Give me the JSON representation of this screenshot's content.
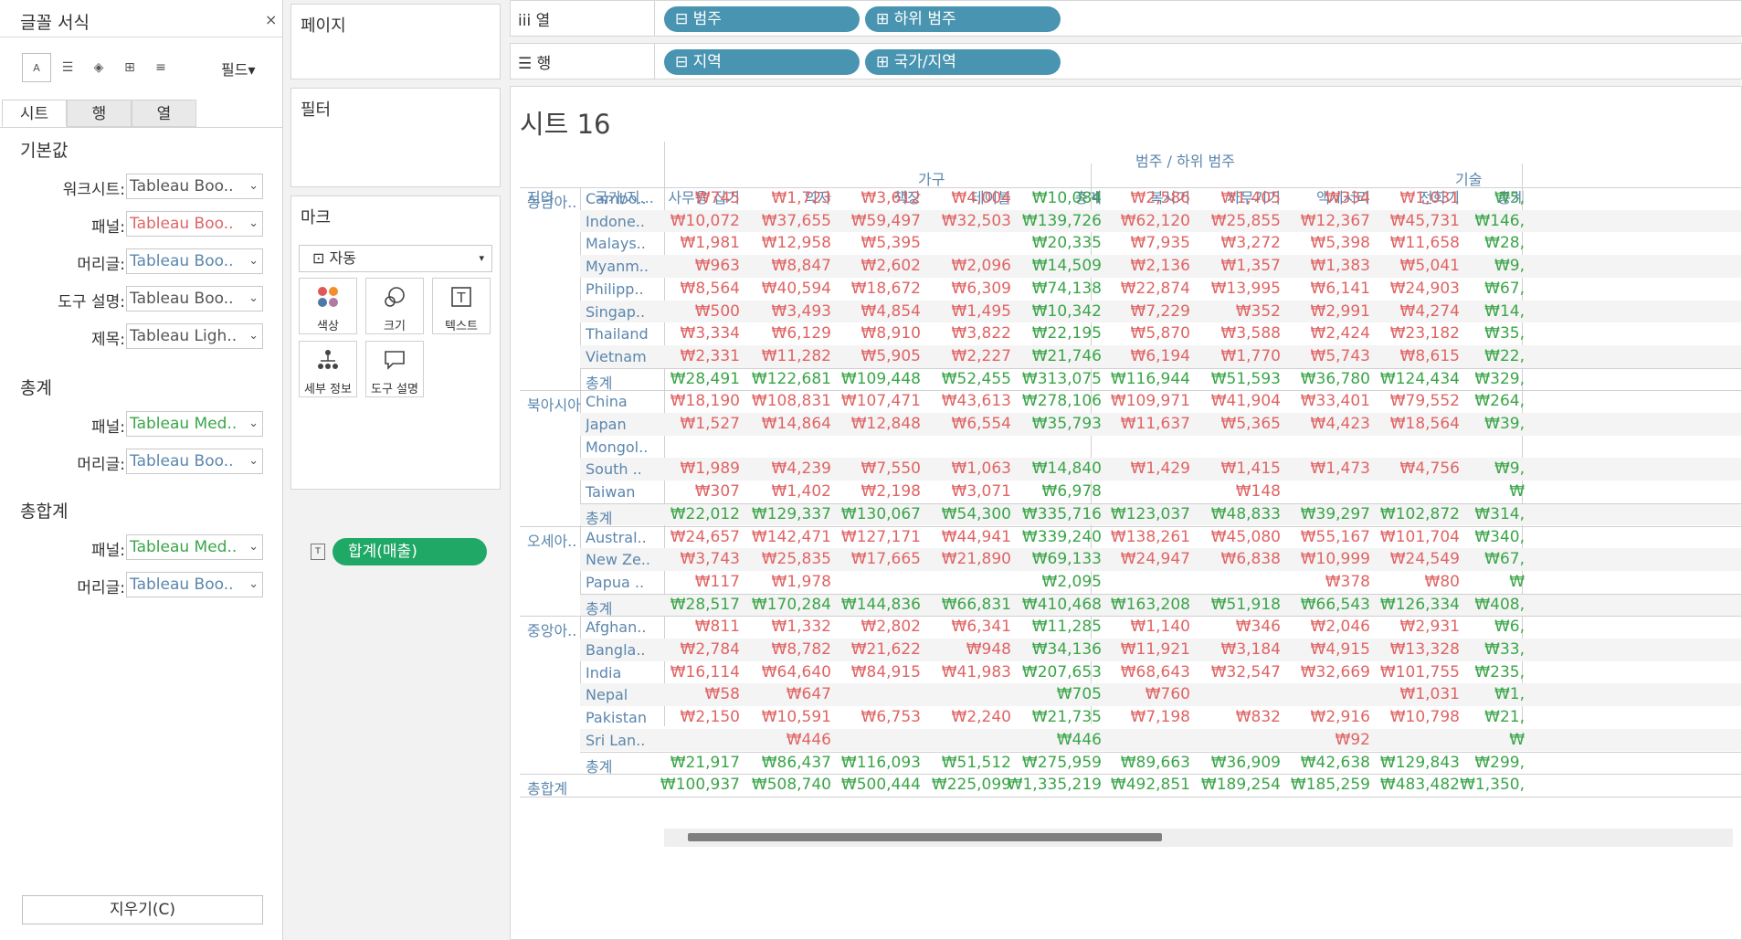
{
  "format_pane": {
    "title": "글꼴 서식",
    "close": "×",
    "fields_button": "필드▾",
    "tabs": [
      "시트",
      "행",
      "열"
    ],
    "sections": [
      {
        "heading": "기본값",
        "rows": [
          {
            "label": "워크시트:",
            "value": "Tableau Boo..",
            "color": "#555555"
          },
          {
            "label": "패널:",
            "value": "Tableau Boo..",
            "color": "#e06464"
          },
          {
            "label": "머리글:",
            "value": "Tableau Boo..",
            "color": "#5b86ad"
          },
          {
            "label": "도구 설명:",
            "value": "Tableau Boo..",
            "color": "#555555"
          },
          {
            "label": "제목:",
            "value": "Tableau Ligh..",
            "color": "#555555"
          }
        ]
      },
      {
        "heading": "총계",
        "rows": [
          {
            "label": "패널:",
            "value": "Tableau Med..",
            "color": "#3aa548"
          },
          {
            "label": "머리글:",
            "value": "Tableau Boo..",
            "color": "#5b86ad"
          }
        ]
      },
      {
        "heading": "총합계",
        "rows": [
          {
            "label": "패널:",
            "value": "Tableau Med..",
            "color": "#3aa548"
          },
          {
            "label": "머리글:",
            "value": "Tableau Boo..",
            "color": "#5b86ad"
          }
        ]
      }
    ],
    "clear_button": "지우기(C)"
  },
  "cards": {
    "pages": "페이지",
    "filters": "필터",
    "marks": {
      "title": "마크",
      "type": "자동",
      "buttons": [
        "색상",
        "크기",
        "텍스트",
        "세부 정보",
        "도구 설명"
      ],
      "pill": "합계(매출)"
    }
  },
  "shelves": {
    "columns": {
      "label": "열",
      "pills": [
        "범주",
        "하위 범주"
      ]
    },
    "rows": {
      "label": "행",
      "pills": [
        "지역",
        "국가/지역"
      ]
    }
  },
  "view": {
    "title": "시트 16",
    "header_top": "범주 / 하위 범주",
    "categories": [
      "가구",
      "기술"
    ],
    "row_headers": [
      "지역",
      "국가/지..."
    ],
    "columns": [
      "사무용 집기",
      "의자",
      "책장",
      "테이블",
      "총계",
      "복사기",
      "사무기기",
      "액세서리",
      "전화기",
      "총계"
    ],
    "regions": [
      {
        "name": "동남아..",
        "rows": [
          {
            "country": "Cambo..",
            "vals": [
              "₩745",
              "₩1,723",
              "₩3,612",
              "₩4,004",
              "₩10,084",
              "₩2,586",
              "₩1,405",
              "₩334",
              "₩1,031",
              "₩5,"
            ]
          },
          {
            "country": "Indone..",
            "vals": [
              "₩10,072",
              "₩37,655",
              "₩59,497",
              "₩32,503",
              "₩139,726",
              "₩62,120",
              "₩25,855",
              "₩12,367",
              "₩45,731",
              "₩146,"
            ]
          },
          {
            "country": "Malays..",
            "vals": [
              "₩1,981",
              "₩12,958",
              "₩5,395",
              "",
              "₩20,335",
              "₩7,935",
              "₩3,272",
              "₩5,398",
              "₩11,658",
              "₩28,"
            ]
          },
          {
            "country": "Myanm..",
            "vals": [
              "₩963",
              "₩8,847",
              "₩2,602",
              "₩2,096",
              "₩14,509",
              "₩2,136",
              "₩1,357",
              "₩1,383",
              "₩5,041",
              "₩9,"
            ]
          },
          {
            "country": "Philipp..",
            "vals": [
              "₩8,564",
              "₩40,594",
              "₩18,672",
              "₩6,309",
              "₩74,138",
              "₩22,874",
              "₩13,995",
              "₩6,141",
              "₩24,903",
              "₩67,"
            ]
          },
          {
            "country": "Singap..",
            "vals": [
              "₩500",
              "₩3,493",
              "₩4,854",
              "₩1,495",
              "₩10,342",
              "₩7,229",
              "₩352",
              "₩2,991",
              "₩4,274",
              "₩14,"
            ]
          },
          {
            "country": "Thailand",
            "vals": [
              "₩3,334",
              "₩6,129",
              "₩8,910",
              "₩3,822",
              "₩22,195",
              "₩5,870",
              "₩3,588",
              "₩2,424",
              "₩23,182",
              "₩35,"
            ]
          },
          {
            "country": "Vietnam",
            "vals": [
              "₩2,331",
              "₩11,282",
              "₩5,905",
              "₩2,227",
              "₩21,746",
              "₩6,194",
              "₩1,770",
              "₩5,743",
              "₩8,615",
              "₩22,"
            ]
          }
        ],
        "total": {
          "label": "총계",
          "vals": [
            "₩28,491",
            "₩122,681",
            "₩109,448",
            "₩52,455",
            "₩313,075",
            "₩116,944",
            "₩51,593",
            "₩36,780",
            "₩124,434",
            "₩329,"
          ]
        }
      },
      {
        "name": "북아시아",
        "rows": [
          {
            "country": "China",
            "vals": [
              "₩18,190",
              "₩108,831",
              "₩107,471",
              "₩43,613",
              "₩278,106",
              "₩109,971",
              "₩41,904",
              "₩33,401",
              "₩79,552",
              "₩264,"
            ]
          },
          {
            "country": "Japan",
            "vals": [
              "₩1,527",
              "₩14,864",
              "₩12,848",
              "₩6,554",
              "₩35,793",
              "₩11,637",
              "₩5,365",
              "₩4,423",
              "₩18,564",
              "₩39,"
            ]
          },
          {
            "country": "Mongol..",
            "vals": [
              "",
              "",
              "",
              "",
              "",
              "",
              "",
              "",
              "",
              ""
            ]
          },
          {
            "country": "South ..",
            "vals": [
              "₩1,989",
              "₩4,239",
              "₩7,550",
              "₩1,063",
              "₩14,840",
              "₩1,429",
              "₩1,415",
              "₩1,473",
              "₩4,756",
              "₩9,"
            ]
          },
          {
            "country": "Taiwan",
            "vals": [
              "₩307",
              "₩1,402",
              "₩2,198",
              "₩3,071",
              "₩6,978",
              "",
              "₩148",
              "",
              "",
              "₩"
            ]
          }
        ],
        "total": {
          "label": "총계",
          "vals": [
            "₩22,012",
            "₩129,337",
            "₩130,067",
            "₩54,300",
            "₩335,716",
            "₩123,037",
            "₩48,833",
            "₩39,297",
            "₩102,872",
            "₩314,"
          ]
        }
      },
      {
        "name": "오세아..",
        "rows": [
          {
            "country": "Austral..",
            "vals": [
              "₩24,657",
              "₩142,471",
              "₩127,171",
              "₩44,941",
              "₩339,240",
              "₩138,261",
              "₩45,080",
              "₩55,167",
              "₩101,704",
              "₩340,"
            ]
          },
          {
            "country": "New Ze..",
            "vals": [
              "₩3,743",
              "₩25,835",
              "₩17,665",
              "₩21,890",
              "₩69,133",
              "₩24,947",
              "₩6,838",
              "₩10,999",
              "₩24,549",
              "₩67,"
            ]
          },
          {
            "country": "Papua ..",
            "vals": [
              "₩117",
              "₩1,978",
              "",
              "",
              "₩2,095",
              "",
              "",
              "₩378",
              "₩80",
              "₩"
            ]
          }
        ],
        "total": {
          "label": "총계",
          "vals": [
            "₩28,517",
            "₩170,284",
            "₩144,836",
            "₩66,831",
            "₩410,468",
            "₩163,208",
            "₩51,918",
            "₩66,543",
            "₩126,334",
            "₩408,"
          ]
        }
      },
      {
        "name": "중앙아..",
        "rows": [
          {
            "country": "Afghan..",
            "vals": [
              "₩811",
              "₩1,332",
              "₩2,802",
              "₩6,341",
              "₩11,285",
              "₩1,140",
              "₩346",
              "₩2,046",
              "₩2,931",
              "₩6,"
            ]
          },
          {
            "country": "Bangla..",
            "vals": [
              "₩2,784",
              "₩8,782",
              "₩21,622",
              "₩948",
              "₩34,136",
              "₩11,921",
              "₩3,184",
              "₩4,915",
              "₩13,328",
              "₩33,"
            ]
          },
          {
            "country": "India",
            "vals": [
              "₩16,114",
              "₩64,640",
              "₩84,915",
              "₩41,983",
              "₩207,653",
              "₩68,643",
              "₩32,547",
              "₩32,669",
              "₩101,755",
              "₩235,"
            ]
          },
          {
            "country": "Nepal",
            "vals": [
              "₩58",
              "₩647",
              "",
              "",
              "₩705",
              "₩760",
              "",
              "",
              "₩1,031",
              "₩1,"
            ]
          },
          {
            "country": "Pakistan",
            "vals": [
              "₩2,150",
              "₩10,591",
              "₩6,753",
              "₩2,240",
              "₩21,735",
              "₩7,198",
              "₩832",
              "₩2,916",
              "₩10,798",
              "₩21,"
            ]
          },
          {
            "country": "Sri Lan..",
            "vals": [
              "",
              "₩446",
              "",
              "",
              "₩446",
              "",
              "",
              "₩92",
              "",
              "₩"
            ]
          }
        ],
        "total": {
          "label": "총계",
          "vals": [
            "₩21,917",
            "₩86,437",
            "₩116,093",
            "₩51,512",
            "₩275,959",
            "₩89,663",
            "₩36,909",
            "₩42,638",
            "₩129,843",
            "₩299,"
          ]
        }
      }
    ],
    "grand_total": {
      "label": "총합계",
      "vals": [
        "₩100,937",
        "₩508,740",
        "₩500,444",
        "₩225,099",
        "₩1,335,219",
        "₩492,851",
        "₩189,254",
        "₩185,259",
        "₩483,482",
        "₩1,350,"
      ]
    }
  }
}
